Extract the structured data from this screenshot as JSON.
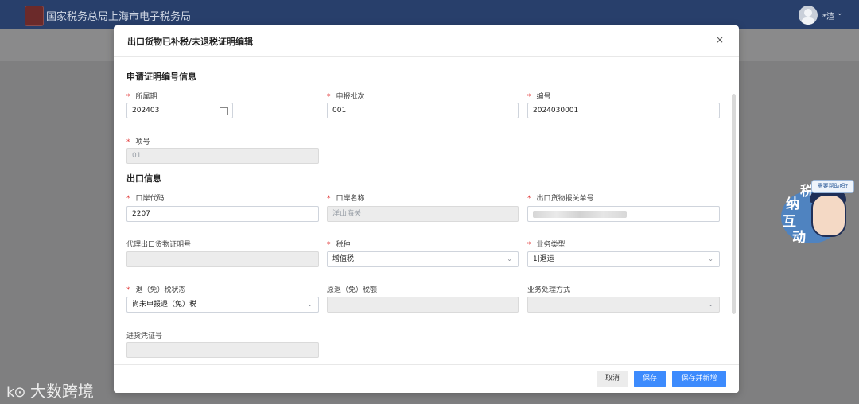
{
  "site": {
    "title": "国家税务总局上海市电子税务局",
    "user_name": "*渲",
    "user_caret": "⌄"
  },
  "dialog": {
    "title": "出口货物已补税/未退税证明编辑",
    "close_glyph": "×",
    "sections": {
      "application": "申请证明编号信息",
      "export": "出口信息"
    },
    "fields": {
      "period": {
        "label": "所属期",
        "value": "202403",
        "required": true
      },
      "batch": {
        "label": "申报批次",
        "value": "001",
        "required": true
      },
      "number": {
        "label": "编号",
        "value": "2024030001",
        "required": true
      },
      "item_no": {
        "label": "项号",
        "value": "01",
        "required": true
      },
      "port_code": {
        "label": "口岸代码",
        "value": "2207",
        "required": true
      },
      "port_name": {
        "label": "口岸名称",
        "value": "洋山海关",
        "required": true
      },
      "customs_declaration": {
        "label": "出口货物报关单号",
        "value": "",
        "required": true
      },
      "agent_cert_no": {
        "label": "代理出口货物证明号",
        "value": "",
        "required": false
      },
      "tax_type": {
        "label": "税种",
        "value": "增值税",
        "required": true
      },
      "business_type": {
        "label": "业务类型",
        "value": "1|退运",
        "required": true
      },
      "refund_status": {
        "label": "退（免）税状态",
        "value": "尚未申报退（免）税",
        "required": true
      },
      "original_refund_amount": {
        "label": "原退（免）税额",
        "value": "",
        "required": false
      },
      "processing_method": {
        "label": "业务处理方式",
        "value": "",
        "required": false
      },
      "purchase_voucher": {
        "label": "进货凭证号",
        "value": "",
        "required": false
      }
    },
    "buttons": {
      "cancel": "取消",
      "save": "保存",
      "save_new": "保存并新增"
    }
  },
  "assistant": {
    "bubble": "需要帮助吗?",
    "chars": [
      "纳",
      "税",
      "互",
      "动"
    ]
  },
  "watermark": {
    "mark": "k⊙",
    "text": "大数跨境"
  },
  "req_mark": "*"
}
